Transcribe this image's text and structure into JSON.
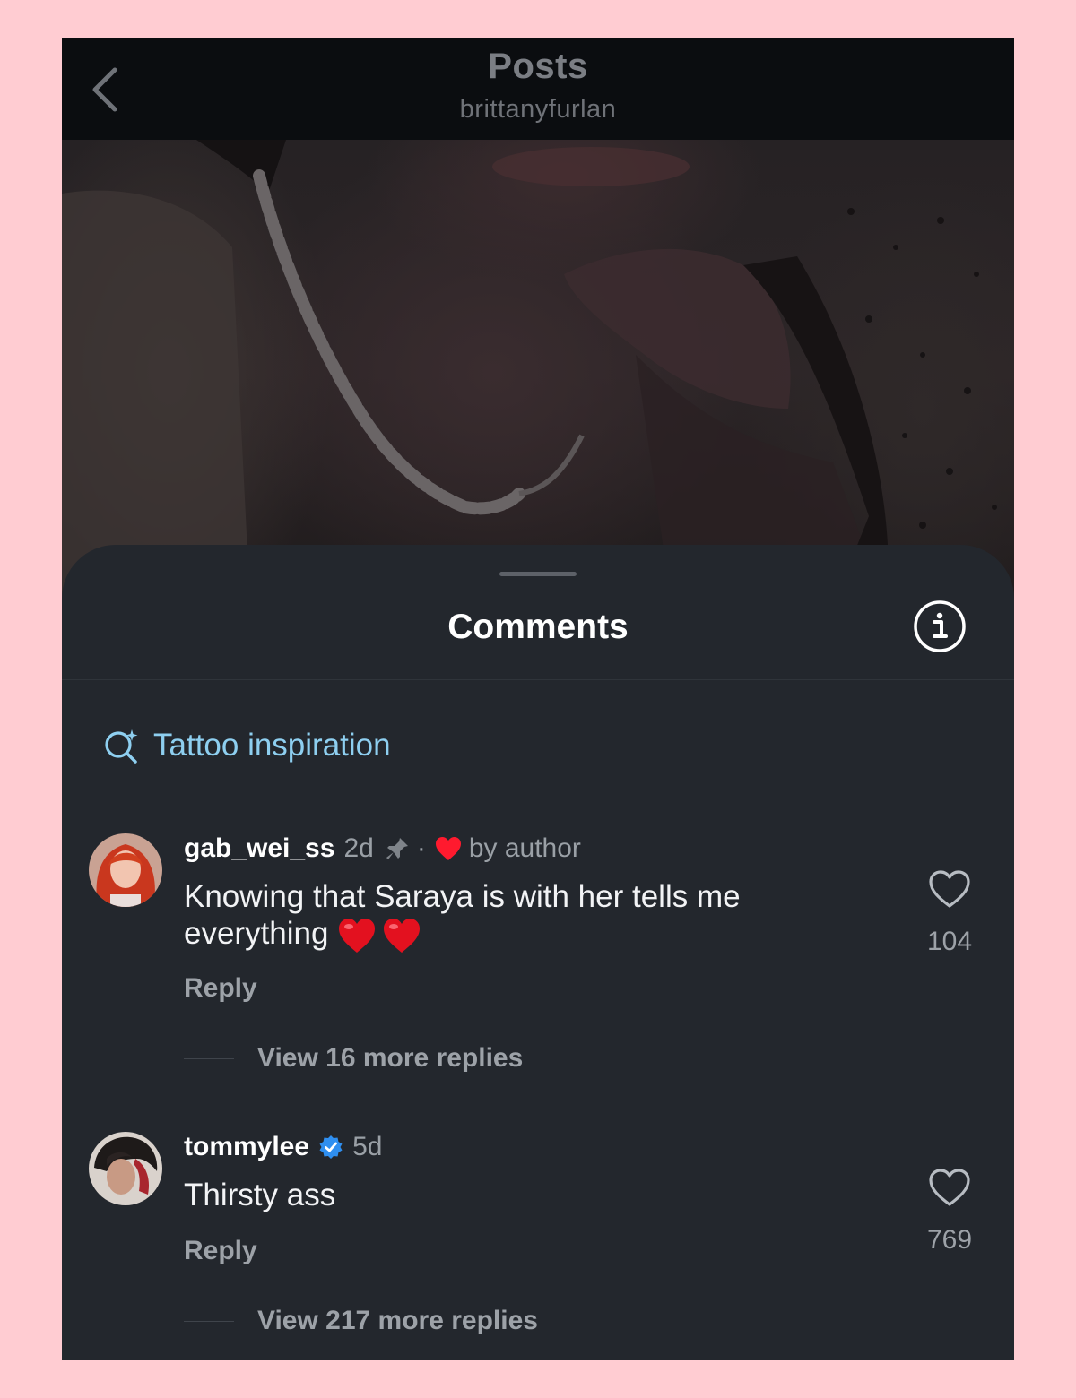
{
  "header": {
    "title": "Posts",
    "subtitle": "brittanyfurlan"
  },
  "sheet": {
    "title": "Comments"
  },
  "search_suggestion": {
    "label": "Tattoo inspiration"
  },
  "comments": [
    {
      "username": "gab_wei_ss",
      "time": "2d",
      "pinned": true,
      "separator": "·",
      "liked_by_author_label": "by author",
      "text": "Knowing that Saraya is with her tells me everything",
      "emoji": "❤️❤️",
      "reply_label": "Reply",
      "more_replies_label": "View 16 more replies",
      "likes": "104"
    },
    {
      "username": "tommylee",
      "verified": true,
      "time": "5d",
      "text": "Thirsty ass",
      "reply_label": "Reply",
      "more_replies_label": "View 217 more replies",
      "likes": "769"
    }
  ],
  "colors": {
    "page_bg": "#ffccd2",
    "sheet_bg": "#23272d",
    "accent_link": "#8ecff0",
    "verified_badge": "#2f8ff0",
    "heart_red": "#ff1a2e"
  },
  "icons": [
    "back-chevron-icon",
    "info-icon",
    "sparkle-search-icon",
    "pin-icon",
    "heart-filled-icon",
    "verified-badge-icon",
    "heart-outline-icon"
  ]
}
